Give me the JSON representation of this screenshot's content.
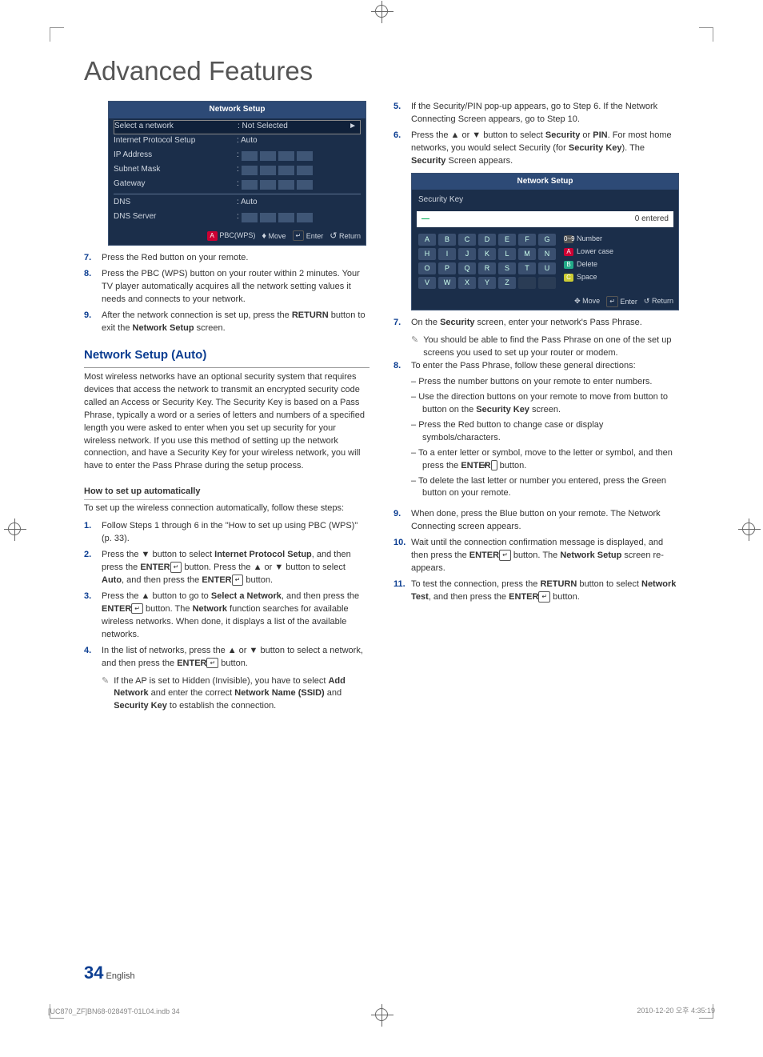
{
  "title": "Advanced Features",
  "page_number": "34",
  "page_lang": "English",
  "footer_left": "[UC870_ZF]BN68-02849T-01L04.indb   34",
  "footer_right": "2010-12-20   오후 4:35:19",
  "panel1": {
    "title": "Network Setup",
    "select_network_label": "Select a network",
    "select_network_value": ": Not Selected",
    "arrow": "►",
    "ips_label": "Internet Protocol Setup",
    "ips_value": ": Auto",
    "ip_label": "IP Address",
    "subnet_label": "Subnet Mask",
    "gateway_label": "Gateway",
    "dns_label": "DNS",
    "dns_value": ": Auto",
    "dnsserver_label": "DNS Server",
    "dot": ":",
    "footer_a": "A",
    "footer_pbc": "PBC(WPS)",
    "footer_move": "Move",
    "footer_enter": "Enter",
    "footer_return": "Return",
    "footer_move_icon": "♦",
    "footer_enter_icon": "↵",
    "footer_return_icon": "↺"
  },
  "panel2": {
    "title": "Network Setup",
    "subtitle": "Security Key",
    "cursor": "—",
    "entered": "0 entered",
    "letters": [
      "A",
      "B",
      "C",
      "D",
      "E",
      "F",
      "G",
      "H",
      "I",
      "J",
      "K",
      "L",
      "M",
      "N",
      "O",
      "P",
      "Q",
      "R",
      "S",
      "T",
      "U",
      "V",
      "W",
      "X",
      "Y",
      "Z",
      " ",
      " "
    ],
    "opt_number": "Number",
    "opt_lower": "Lower case",
    "opt_delete": "Delete",
    "opt_space": "Space",
    "opt_num_chip": "0~9",
    "opt_red_chip": "A",
    "opt_green_chip": "B",
    "opt_yellow_chip": "C",
    "footer_move_icon": "✥",
    "footer_move": "Move",
    "footer_enter_icon": "↵",
    "footer_enter": "Enter",
    "footer_return_icon": "↺",
    "footer_return": "Return"
  },
  "left_steps": {
    "s7": {
      "n": "7.",
      "t": "Press the Red button on your remote."
    },
    "s8": {
      "n": "8.",
      "t": "Press the PBC (WPS) button on your router within 2 minutes. Your TV player automatically acquires all the network setting values it needs and connects to your network."
    },
    "s9": {
      "n": "9.",
      "t_pre": "After the network connection is set up, press the ",
      "b1": "RETURN",
      "t_mid": " button to exit the ",
      "b2": "Network Setup",
      "t_post": " screen."
    }
  },
  "auto_heading": "Network Setup (Auto)",
  "auto_intro": "Most wireless networks have an optional security system that requires devices that access the network to transmit an encrypted security code called an Access or Security Key. The Security Key is based on a Pass Phrase, typically a word or a series of letters and numbers of a specified length you were asked to enter when you set up security for your wireless network. If you use this method of setting up the network connection, and have a Security Key for your wireless network, you will have to enter the Pass Phrase during the setup process.",
  "subhead_auto": "How to set up automatically",
  "auto_lead": "To set up the wireless connection automatically, follow these steps:",
  "auto_steps": {
    "s1": {
      "n": "1.",
      "t": "Follow Steps 1 through 6 in the \"How to set up using PBC (WPS)\" (p. 33)."
    },
    "s2": {
      "n": "2.",
      "pre": "Press the ▼ button to select ",
      "b1": "Internet Protocol Setup",
      "mid1": ", and then press the ",
      "b2": "ENTER",
      "enter_icon": "↵",
      "mid2": " button. Press the ▲ or ▼ button to select ",
      "b3": "Auto",
      "mid3": ", and then press the ",
      "b4": "ENTER",
      "post": " button."
    },
    "s3": {
      "n": "3.",
      "pre": "Press the ▲ button to go to ",
      "b1": "Select a Network",
      "mid": ", and then press the ",
      "b2": "ENTER",
      "enter_icon": "↵",
      "mid2": " button. The ",
      "b3": "Network",
      "post": " function searches for available wireless networks. When done, it displays a list of the available networks."
    },
    "s4": {
      "n": "4.",
      "pre": "In the list of networks, press the ▲ or ▼ button to select a network, and then press the ",
      "b1": "ENTER",
      "enter_icon": "↵",
      "post": " button."
    },
    "note": {
      "icon": "✎",
      "pre": "If the AP is set to Hidden (Invisible), you have to select ",
      "b1": "Add Network",
      "mid": " and enter the correct ",
      "b2": "Network Name (SSID)",
      "mid2": " and ",
      "b3": "Security Key",
      "post": " to establish the connection."
    }
  },
  "right_steps": {
    "s5": {
      "n": "5.",
      "t": "If the Security/PIN pop-up appears, go to Step 6. If the Network Connecting Screen appears, go to Step 10."
    },
    "s6": {
      "n": "6.",
      "pre": "Press the ▲ or ▼ button to select ",
      "b1": "Security",
      "mid1": " or ",
      "b2": "PIN",
      "mid2": ". For most home networks, you would select Security (for ",
      "b3": "Security Key",
      "mid3": "). The ",
      "b4": "Security",
      "post": " Screen appears."
    },
    "s7": {
      "n": "7.",
      "pre": "On the ",
      "b1": "Security",
      "post": " screen, enter your network's Pass Phrase."
    },
    "note7": {
      "icon": "✎",
      "t": "You should be able to find the Pass Phrase on one of the set up screens you used to set up your router or modem."
    },
    "s8": {
      "n": "8.",
      "t": "To enter the Pass Phrase, follow these general directions:",
      "d1": "Press the number buttons on your remote to enter numbers.",
      "d2_pre": "Use the direction buttons on your remote to move from button to button on the ",
      "d2_b": "Security Key",
      "d2_post": " screen.",
      "d3": "Press the Red button to change case or display symbols/characters.",
      "d4_pre": "To a enter letter or symbol, move to the letter or symbol, and then press the ",
      "d4_b": "ENTER",
      "d4_icon": "↵",
      "d4_post": " button.",
      "d5": "To delete the last letter or number you entered, press the Green button on your remote."
    },
    "s9": {
      "n": "9.",
      "t": "When done, press the Blue button on your remote. The Network Connecting screen appears."
    },
    "s10": {
      "n": "10.",
      "pre": "Wait until the connection confirmation message is displayed, and then press the ",
      "b1": "ENTER",
      "icon": "↵",
      "mid": " button. The ",
      "b2": "Network Setup",
      "post": " screen re-appears."
    },
    "s11": {
      "n": "11.",
      "pre": "To test the connection, press the ",
      "b1": "RETURN",
      "mid": " button to select ",
      "b2": "Network Test",
      "mid2": ", and then press the ",
      "b3": "ENTER",
      "icon": "↵",
      "post": " button."
    }
  }
}
